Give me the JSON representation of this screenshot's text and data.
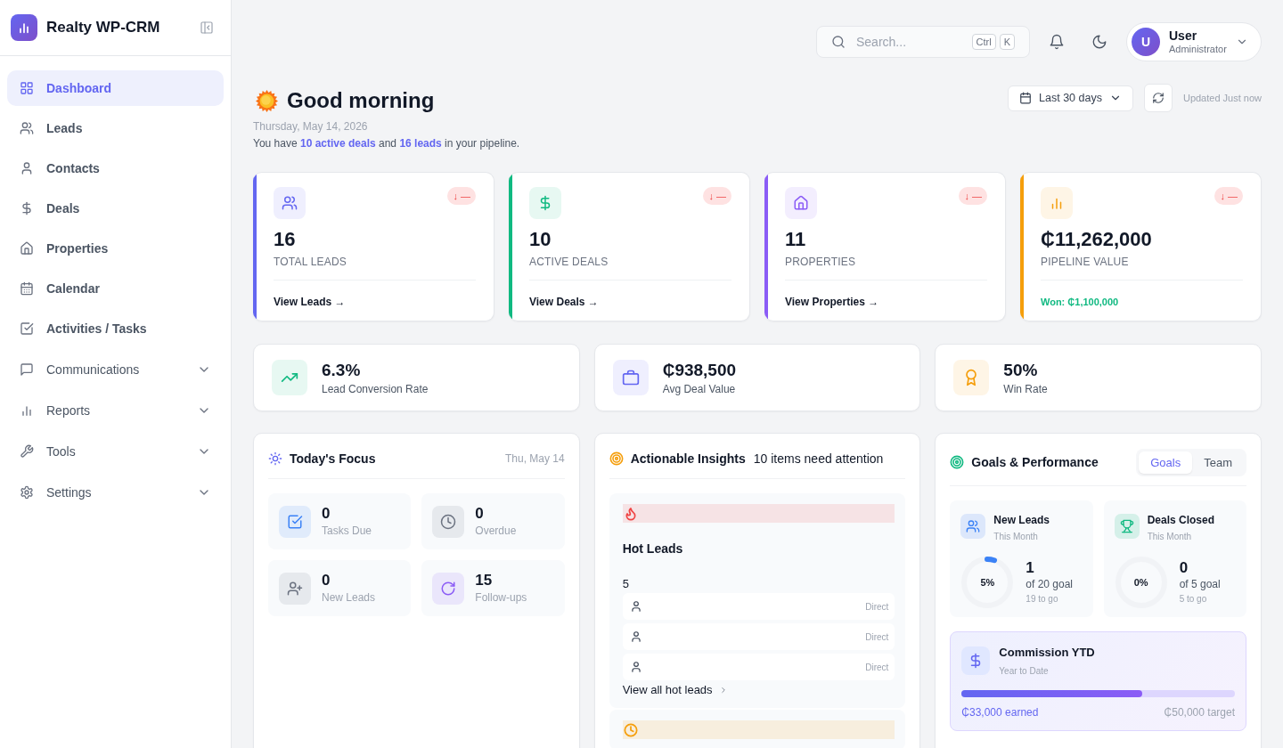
{
  "sidebar": {
    "brand": "Realty WP-CRM",
    "items": [
      {
        "label": "Dashboard",
        "selected": true,
        "expandable": false
      },
      {
        "label": "Leads",
        "selected": false,
        "expandable": false
      },
      {
        "label": "Contacts",
        "selected": false,
        "expandable": false
      },
      {
        "label": "Deals",
        "selected": false,
        "expandable": false
      },
      {
        "label": "Properties",
        "selected": false,
        "expandable": false
      },
      {
        "label": "Calendar",
        "selected": false,
        "expandable": false
      },
      {
        "label": "Activities / Tasks",
        "selected": false,
        "expandable": false
      },
      {
        "label": "Communications",
        "selected": false,
        "expandable": true
      },
      {
        "label": "Reports",
        "selected": false,
        "expandable": true
      },
      {
        "label": "Tools",
        "selected": false,
        "expandable": true
      },
      {
        "label": "Settings",
        "selected": false,
        "expandable": true
      }
    ]
  },
  "topbar": {
    "search": {
      "placeholder": "Search...",
      "keys": [
        "Ctrl",
        "K"
      ]
    },
    "user": {
      "initial": "U",
      "name": "User",
      "role": "Administrator"
    }
  },
  "greeting": {
    "title": "Good morning",
    "date": "Thursday, May 14, 2026",
    "summary": "You have **10 active deals** and **16 leads** in your pipeline.",
    "range": "Last 30 days",
    "updated": "Updated Just now"
  },
  "stat_cards": [
    {
      "value": "16",
      "label": "TOTAL LEADS",
      "trend": "↓ —",
      "color": "#6366f1",
      "footer": {
        "kind": "link",
        "text": "View Leads →"
      }
    },
    {
      "value": "10",
      "label": "ACTIVE DEALS",
      "trend": "↓ —",
      "color": "#10b981",
      "footer": {
        "kind": "link",
        "text": "View Deals →"
      }
    },
    {
      "value": "11",
      "label": "PROPERTIES",
      "trend": "↓ —",
      "color": "#8b5cf6",
      "footer": {
        "kind": "link",
        "text": "View Properties →"
      }
    },
    {
      "value": "₵11,262,000",
      "label": "PIPELINE VALUE",
      "trend": "↓ —",
      "color": "#f59e0b",
      "footer": {
        "kind": "note",
        "text": "Won: ₵1,100,000"
      }
    }
  ],
  "metrics": [
    {
      "value": "6.3%",
      "label": "Lead Conversion Rate",
      "color": "#10b981"
    },
    {
      "value": "₵938,500",
      "label": "Avg Deal Value",
      "color": "#6366f1"
    },
    {
      "value": "50%",
      "label": "Win Rate",
      "color": "#f59e0b"
    }
  ],
  "focus": {
    "title": "Today's Focus",
    "date": "Thu, May 14",
    "items": [
      {
        "value": "0",
        "label": "Tasks Due",
        "color": "#3b82f6"
      },
      {
        "value": "0",
        "label": "Overdue",
        "color": "#6b7280"
      },
      {
        "value": "0",
        "label": "New Leads",
        "color": "#6b7280"
      },
      {
        "value": "15",
        "label": "Follow-ups",
        "color": "#8b5cf6"
      }
    ]
  },
  "insights": {
    "title": "Actionable Insights",
    "subtitle": "10 items need attention",
    "groups": [
      {
        "color": "#ef4444",
        "title": "Hot Leads",
        "count": "5",
        "rows": [
          {
            "source": "Direct"
          },
          {
            "source": "Direct"
          },
          {
            "source": "Direct"
          }
        ],
        "link": "View all hot leads"
      },
      {
        "color": "#f59e0b"
      }
    ]
  },
  "goals": {
    "title": "Goals & Performance",
    "tabs": [
      {
        "label": "Goals",
        "selected": true
      },
      {
        "label": "Team",
        "selected": false
      }
    ],
    "cards": [
      {
        "title": "New Leads",
        "period": "This Month",
        "percent": "5%",
        "level": 0.05,
        "value": "1",
        "goal": "of 20 goal",
        "remaining": "19 to go",
        "color": "#3b82f6"
      },
      {
        "title": "Deals Closed",
        "period": "This Month",
        "percent": "0%",
        "level": 0,
        "value": "0",
        "goal": "of 5 goal",
        "remaining": "5 to go",
        "color": "#10b981"
      }
    ],
    "commission": {
      "title": "Commission YTD",
      "period": "Year to Date",
      "level": 0.66,
      "earned": "₵33,000 earned",
      "target": "₵50,000 target"
    }
  }
}
